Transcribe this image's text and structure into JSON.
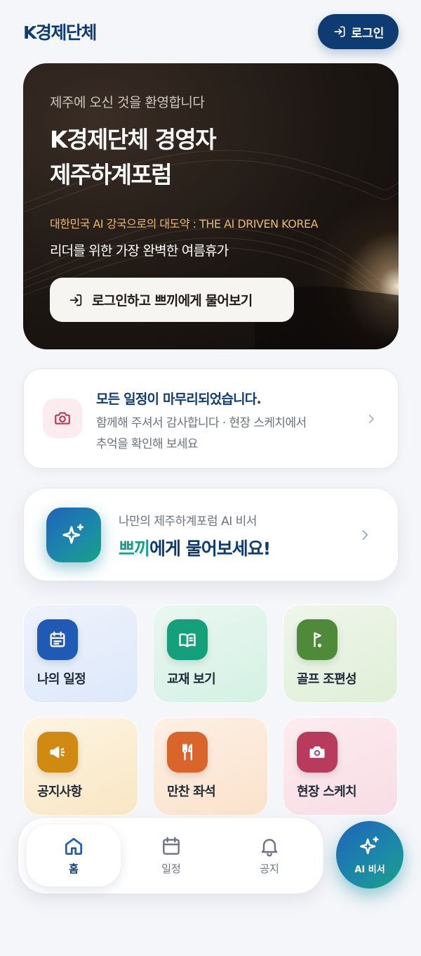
{
  "header": {
    "brand": "K경제단체",
    "login_label": "로그인"
  },
  "hero": {
    "welcome": "제주에 오신 것을 환영합니다",
    "title_line1": "K경제단체 경영자",
    "title_line2": "제주하계포럼",
    "tagline": "대한민국 AI 강국으로의 대도약 : THE AI DRIVEN KOREA",
    "description": "리더를 위한 가장 완벽한 여름휴가",
    "cta_label": "로그인하고 쁘끼에게 물어보기"
  },
  "schedule_done": {
    "title": "모든 일정이 마무리되었습니다.",
    "desc_line1": "함께해 주셔서 감사합니다 · 현장 스케치에서",
    "desc_line2": "추억을 확인해 보세요"
  },
  "ai_card": {
    "subtitle": "나만의 제주하계포럼 AI 비서",
    "title_accent": "쁘끼",
    "title_rest": "에게 물어보세요!"
  },
  "menu": [
    {
      "label": "나의 일정",
      "icon": "schedule-icon",
      "color": "#1f5bb5"
    },
    {
      "label": "교재 보기",
      "icon": "book-icon",
      "color": "#14a07a"
    },
    {
      "label": "골프 조편성",
      "icon": "golf-flag-icon",
      "color": "#4f8a3a"
    },
    {
      "label": "공지사항",
      "icon": "megaphone-icon",
      "color": "#d08a12"
    },
    {
      "label": "만찬 좌석",
      "icon": "utensils-icon",
      "color": "#d9652a"
    },
    {
      "label": "현장 스케치",
      "icon": "camera-icon",
      "color": "#b83a5c"
    }
  ],
  "bottom_nav": {
    "home": "홈",
    "schedule": "일정",
    "notice": "공지",
    "ai_fab": "AI 비서"
  },
  "colors": {
    "brand": "#0f3b73",
    "accent_teal": "#14a08a",
    "hero_tag": "#e9b86e"
  }
}
